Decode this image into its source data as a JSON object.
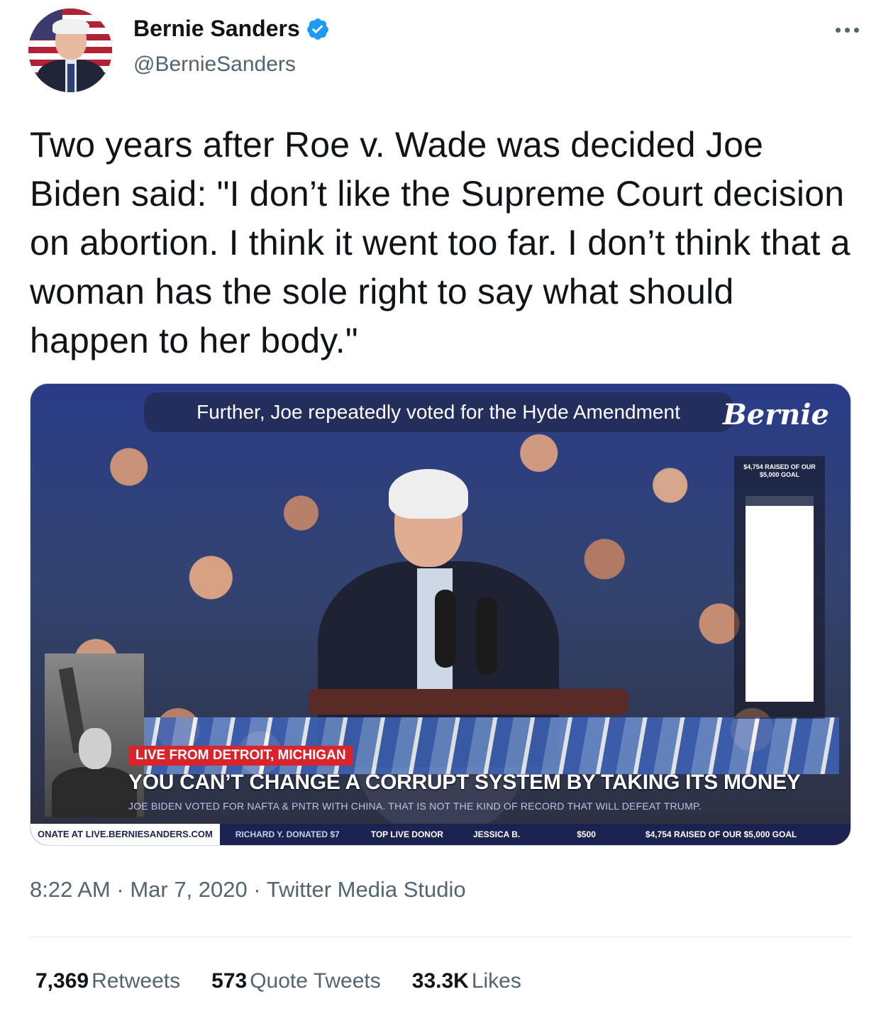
{
  "author": {
    "name": "Bernie Sanders",
    "handle": "@BernieSanders",
    "verified": true,
    "verified_color": "#1d9bf0"
  },
  "menu_icon": "more-dots-icon",
  "tweet_text": "Two years after Roe v. Wade was decided Joe Biden said: \"I don’t like the Supreme Court decision on abortion. I think it went too far. I don’t think that a woman has the sole right to say what should happen to her body.\"",
  "media": {
    "top_caption": "Further, Joe repeatedly voted for the Hyde Amendment",
    "logo": "Bernie",
    "goal_label": "$4,754 RAISED OF OUR $5,000 GOAL",
    "goal_progress": 0.9508,
    "live_badge": "LIVE FROM DETROIT, MICHIGAN",
    "headline": "YOU CAN’T CHANGE A CORRUPT SYSTEM BY TAKING ITS MONEY",
    "subline": "JOE BIDEN VOTED FOR NAFTA & PNTR WITH CHINA. THAT IS NOT THE KIND OF RECORD THAT WILL DEFEAT TRUMP.",
    "ticker": {
      "donate": "ONATE AT LIVE.BERNIESANDERS.COM",
      "donor_message": "RICHARD Y. DONATED $7",
      "top_donor_label": "TOP LIVE DONOR",
      "top_donor_name": "JESSICA B.",
      "top_donor_amount": "$500",
      "raised": "$4,754 RAISED OF OUR $5,000 GOAL"
    }
  },
  "meta": {
    "time": "8:22 AM",
    "separator": " · ",
    "date": "Mar 7, 2020",
    "source": "Twitter Media Studio"
  },
  "stats": {
    "retweets_count": "7,369",
    "retweets_label": "Retweets",
    "quotes_count": "573",
    "quotes_label": "Quote Tweets",
    "likes_count": "33.3K",
    "likes_label": "Likes"
  }
}
